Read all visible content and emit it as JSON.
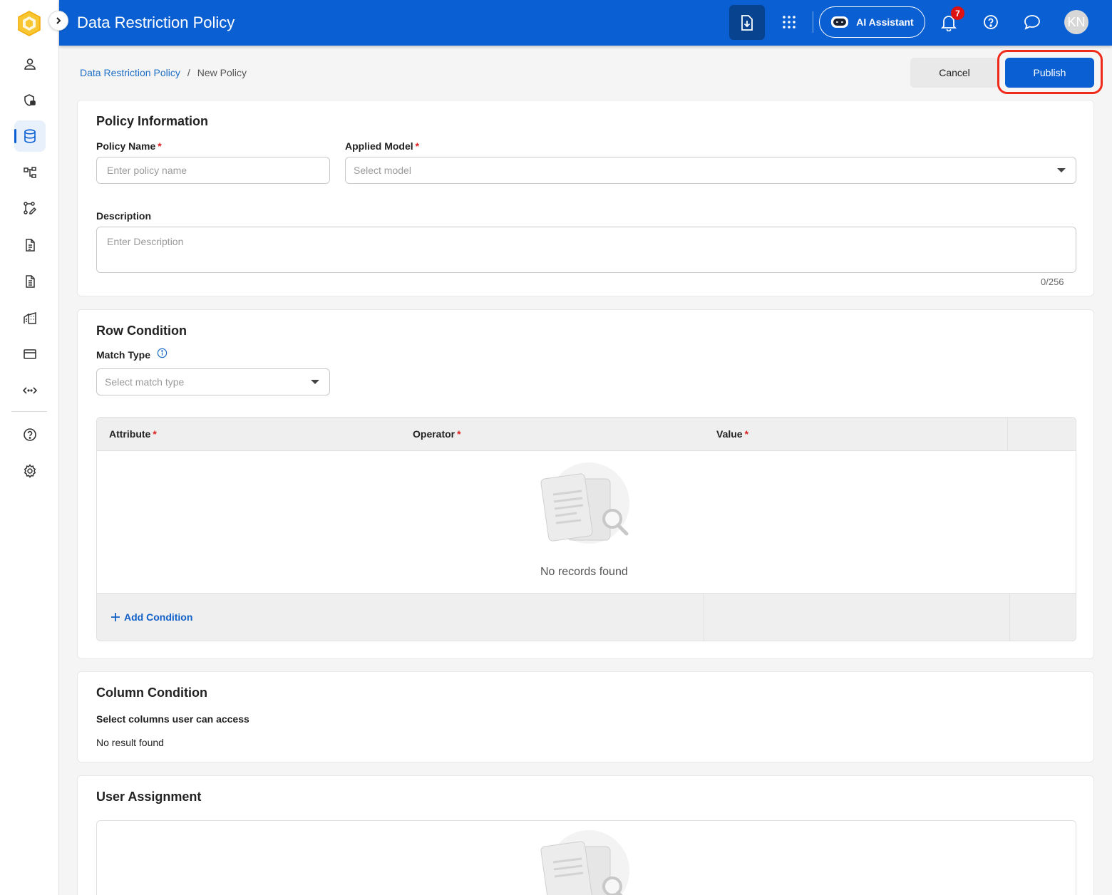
{
  "app": {
    "title": "Data Restriction Policy"
  },
  "topbar": {
    "ai_assistant_label": "AI Assistant",
    "notification_count": "7",
    "avatar_initials": "KN"
  },
  "sidebar": {
    "items": [
      {
        "icon": "user-icon"
      },
      {
        "icon": "shield-lock-icon"
      },
      {
        "icon": "database-icon",
        "active": true
      },
      {
        "icon": "hierarchy-icon"
      },
      {
        "icon": "workflow-edit-icon"
      },
      {
        "icon": "document-icon"
      },
      {
        "icon": "document-list-icon"
      },
      {
        "icon": "buildings-icon"
      },
      {
        "icon": "card-icon"
      },
      {
        "icon": "code-arrows-icon"
      },
      {
        "icon": "help-icon"
      },
      {
        "icon": "settings-icon"
      }
    ]
  },
  "breadcrumb": {
    "parent": "Data Restriction Policy",
    "separator": "/",
    "current": "New Policy"
  },
  "actions": {
    "cancel_label": "Cancel",
    "publish_label": "Publish"
  },
  "policy_info": {
    "title": "Policy Information",
    "policy_name_label": "Policy Name",
    "policy_name_placeholder": "Enter policy name",
    "applied_model_label": "Applied Model",
    "applied_model_placeholder": "Select model",
    "description_label": "Description",
    "description_placeholder": "Enter Description",
    "description_counter": "0/256",
    "required_mark": "*"
  },
  "row_condition": {
    "title": "Row Condition",
    "match_type_label": "Match Type",
    "match_type_placeholder": "Select match type",
    "columns": [
      "Attribute",
      "Operator",
      "Value"
    ],
    "empty_text": "No records found",
    "add_condition_label": "Add Condition"
  },
  "column_condition": {
    "title": "Column Condition",
    "subtitle": "Select columns user can access",
    "empty_text": "No result found"
  },
  "user_assignment": {
    "title": "User Assignment"
  },
  "colors": {
    "primary": "#0a5fd2",
    "highlight": "#ef2a1a",
    "required": "#e02020"
  }
}
